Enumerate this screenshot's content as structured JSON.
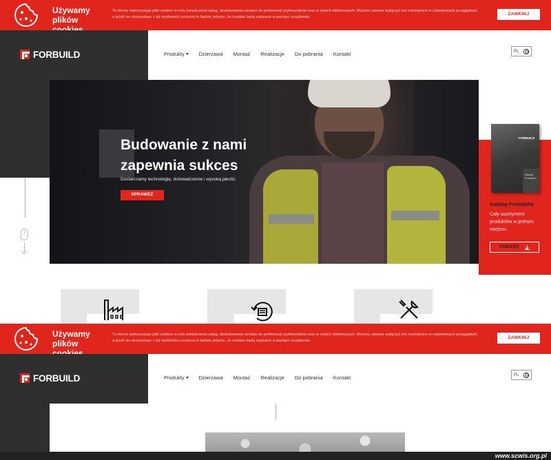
{
  "cookie": {
    "title": "Używamy plików cookies",
    "text": "Ta strona wykorzystuje pliki cookies w celu świadczenia usług, dostosowania serwisu do preferencji użytkowników oraz w celach reklamowych. Możesz zawsze wyłączyć ten mechanizm w ustawieniach przeglądarki, a jeżeli nie skorzystasz z tej możliwości oznacza to będzie jedynie, że cookies będą zapisane w pamięci urządzenia.",
    "button": "ZAMKNIJ"
  },
  "header": {
    "logo": "FORBUILD",
    "nav": [
      "Produkty",
      "Dzierżawa",
      "Montaż",
      "Realizacje",
      "Do pobrania",
      "Kontakt"
    ],
    "lang": "PL"
  },
  "hero": {
    "title": "Budowanie z nami zapewnia sukces",
    "subtitle": "Dostarczamy technologię, doświadczenie i wysoką jakość.",
    "button": "SPRAWDŹ"
  },
  "catalog": {
    "book_logo": "FORBUILD",
    "book_title": "Katalog Produktów",
    "title": "Katalog Produktów",
    "desc": "Cały asortyment produktów w jednym miejscu",
    "button": "POBIERZ"
  },
  "watermark": "www.scwis.org.pl",
  "colors": {
    "accent": "#e0261c",
    "dark": "#2f2f2f"
  }
}
